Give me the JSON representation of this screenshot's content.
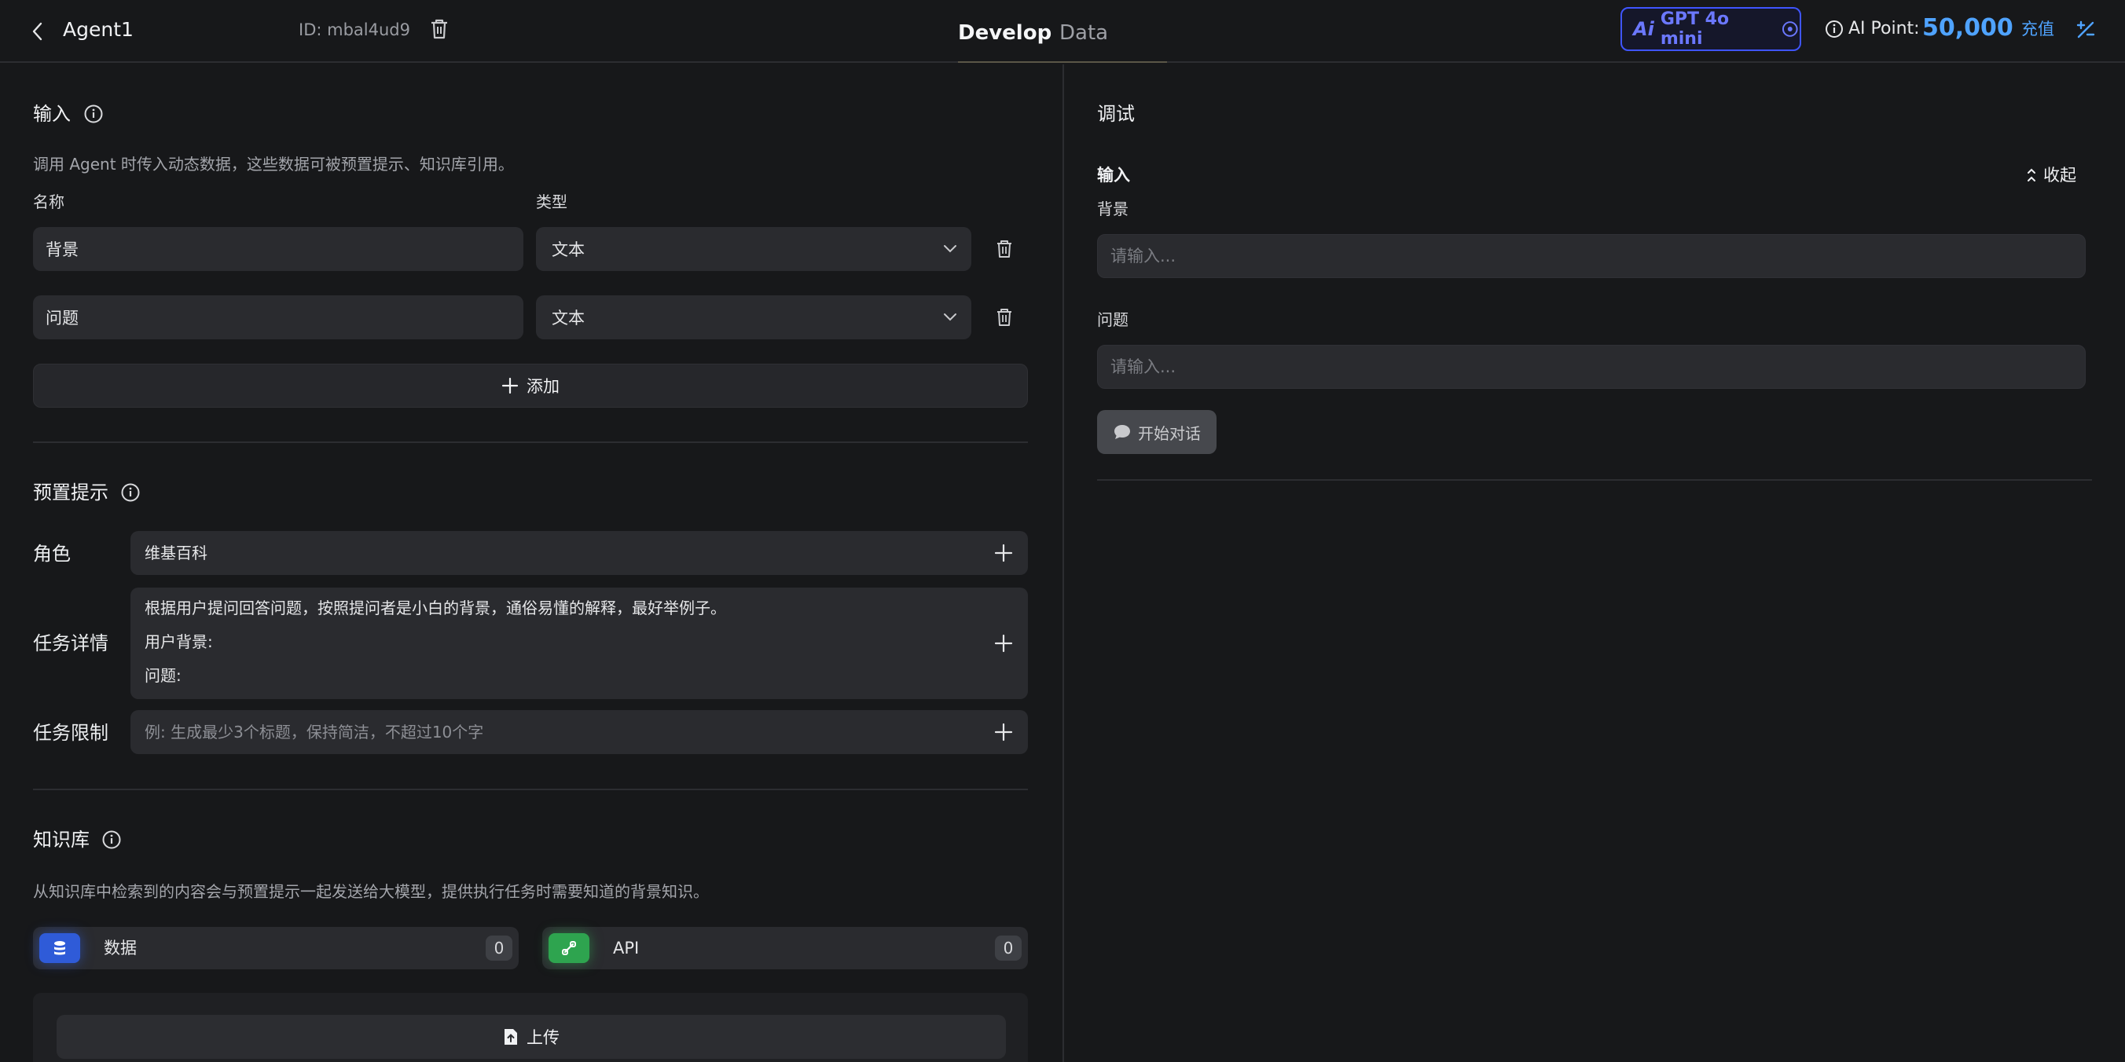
{
  "header": {
    "agent_name": "Agent1",
    "agent_id": "ID: mbal4ud9",
    "tabs": [
      {
        "label": "Develop",
        "active": true
      },
      {
        "label": "Data",
        "active": false
      }
    ],
    "model_logo": "Ai",
    "model_name": "GPT 4o mini",
    "ai_point_label": "AI Point:",
    "ai_point_value": "50,000",
    "recharge_label": "充值",
    "accent_color": "#4fa3ff",
    "model_color": "#3f55ff"
  },
  "inputs_section": {
    "title": "输入",
    "description": "调用 Agent 时传入动态数据，这些数据可被预置提示、知识库引用。",
    "col_name": "名称",
    "col_type": "类型",
    "rows": [
      {
        "name": "背景",
        "type": "文本"
      },
      {
        "name": "问题",
        "type": "文本"
      }
    ],
    "add_label": "添加"
  },
  "preset_section": {
    "title": "预置提示",
    "role_label": "角色",
    "role_value": "维基百科",
    "task_label": "任务详情",
    "task_lines": [
      "根据用户提问回答问题，按照提问者是小白的背景，通俗易懂的解释，最好举例子。",
      "用户背景:",
      "问题:"
    ],
    "limit_label": "任务限制",
    "limit_placeholder": "例: 生成最少3个标题，保持简洁，不超过10个字"
  },
  "knowledge_section": {
    "title": "知识库",
    "description": "从知识库中检索到的内容会与预置提示一起发送给大模型，提供执行任务时需要知道的背景知识。",
    "cards": [
      {
        "name": "数据",
        "count": "0",
        "icon": "database-icon",
        "color": "#2f5bd8"
      },
      {
        "name": "API",
        "count": "0",
        "icon": "api-link-icon",
        "color": "#2ea44f"
      }
    ],
    "upload_label": "上传"
  },
  "debug_panel": {
    "title": "调试",
    "input_label": "输入",
    "collapse_label": "收起",
    "fields": [
      {
        "label": "背景",
        "placeholder": "请输入..."
      },
      {
        "label": "问题",
        "placeholder": "请输入..."
      }
    ],
    "start_label": "开始对话"
  }
}
